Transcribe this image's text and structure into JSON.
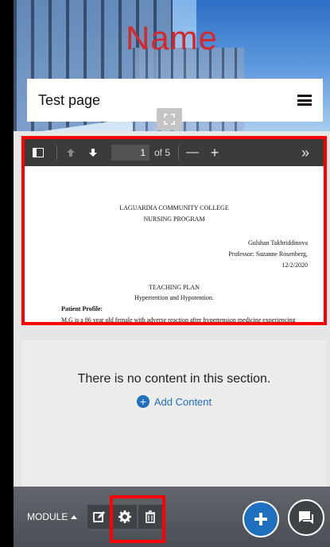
{
  "header": {
    "site_name": "Name",
    "page_title": "Test page"
  },
  "pdf_viewer": {
    "current_page": "1",
    "total_pages_label": "of 5",
    "zoom_out_label": "—",
    "zoom_in_label": "+",
    "more_label": "»",
    "document_lines": [
      "LAGUARDIA COMMUNITY COLLEGE",
      "NURSING PROGRAM",
      "Gulshan Takhriddinova",
      "Professor: Suzanne Rosenberg,",
      "12/2/2020",
      "TEACHING PLAN",
      "Hypertention and Hypotention.",
      "Patient Profile:",
      "M.G is a 86 year old female with adverse reaction after hypertension medicine experiencing"
    ]
  },
  "empty_section": {
    "message": "There is no content in this section.",
    "add_content_label": "Add Content"
  },
  "module_bar": {
    "module_label": "MODULE"
  },
  "colors": {
    "highlight": "#ff0000",
    "site_name": "#d62828",
    "accent": "#1f6fbf"
  }
}
